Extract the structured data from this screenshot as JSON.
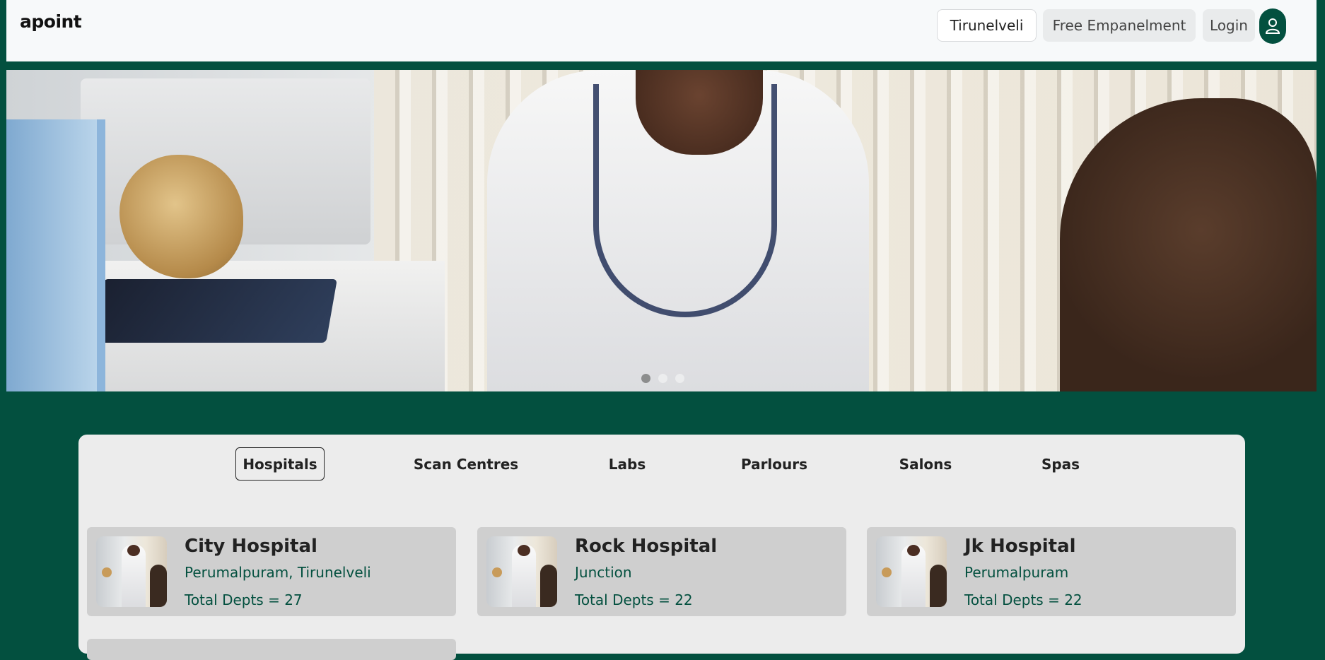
{
  "header": {
    "brand": "apoint",
    "city_button": "Tirunelveli",
    "empanelment_button": "Free Empanelment",
    "login_button": "Login",
    "user_icon": "user-icon"
  },
  "hero": {
    "slide_count": 3,
    "active_slide": 1
  },
  "tabs": [
    {
      "label": "Hospitals",
      "active": true
    },
    {
      "label": "Scan Centres",
      "active": false
    },
    {
      "label": "Labs",
      "active": false
    },
    {
      "label": "Parlours",
      "active": false
    },
    {
      "label": "Salons",
      "active": false
    },
    {
      "label": "Spas",
      "active": false
    }
  ],
  "listings": [
    {
      "name": "City Hospital",
      "location": "Perumalpuram, Tirunelveli",
      "depts": "Total Depts = 27"
    },
    {
      "name": "Rock Hospital",
      "location": "Junction",
      "depts": "Total Depts = 22"
    },
    {
      "name": "Jk Hospital",
      "location": "Perumalpuram",
      "depts": "Total Depts = 22"
    }
  ],
  "colors": {
    "brand_green": "#03503f",
    "panel_bg": "#ececec",
    "card_bg": "#cfcfcf"
  }
}
